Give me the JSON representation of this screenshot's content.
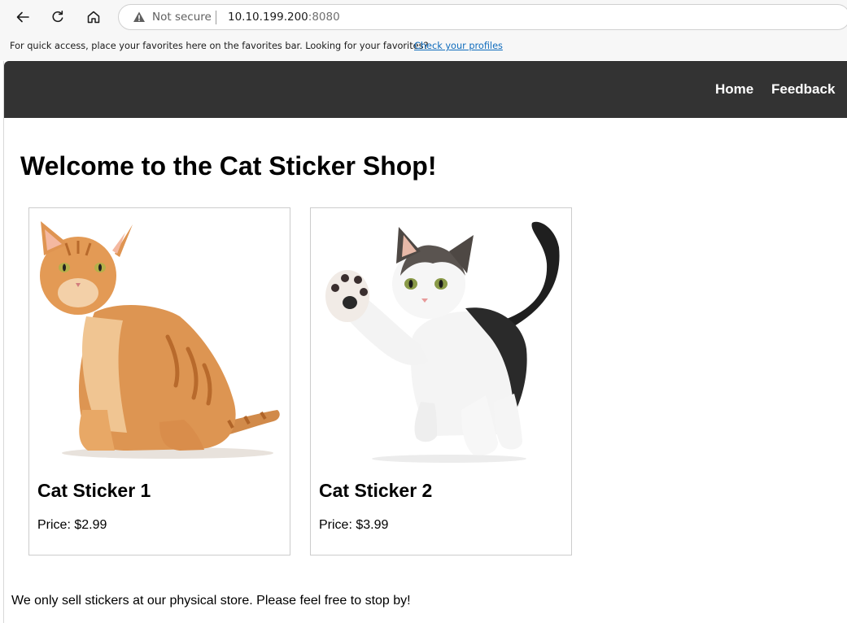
{
  "browser": {
    "security_label": "Not secure",
    "url_host": "10.10.199.200",
    "url_port": ":8080",
    "icons": [
      "back-icon",
      "refresh-icon",
      "home-icon",
      "warning-icon"
    ]
  },
  "favorites_bar": {
    "message": "For quick access, place your favorites here on the favorites bar. Looking for your favorites?",
    "link": "Check your profiles"
  },
  "site": {
    "nav": {
      "home": "Home",
      "feedback": "Feedback"
    },
    "title": "Welcome to the Cat Sticker Shop!",
    "products": [
      {
        "name": "Cat Sticker 1",
        "price": "Price: $2.99"
      },
      {
        "name": "Cat Sticker 2",
        "price": "Price: $3.99"
      }
    ],
    "footer": "We only sell stickers at our physical store. Please feel free to stop by!"
  },
  "colors": {
    "navbar": "#333333",
    "link": "#0f6cbd",
    "card_border": "#cccccc"
  }
}
